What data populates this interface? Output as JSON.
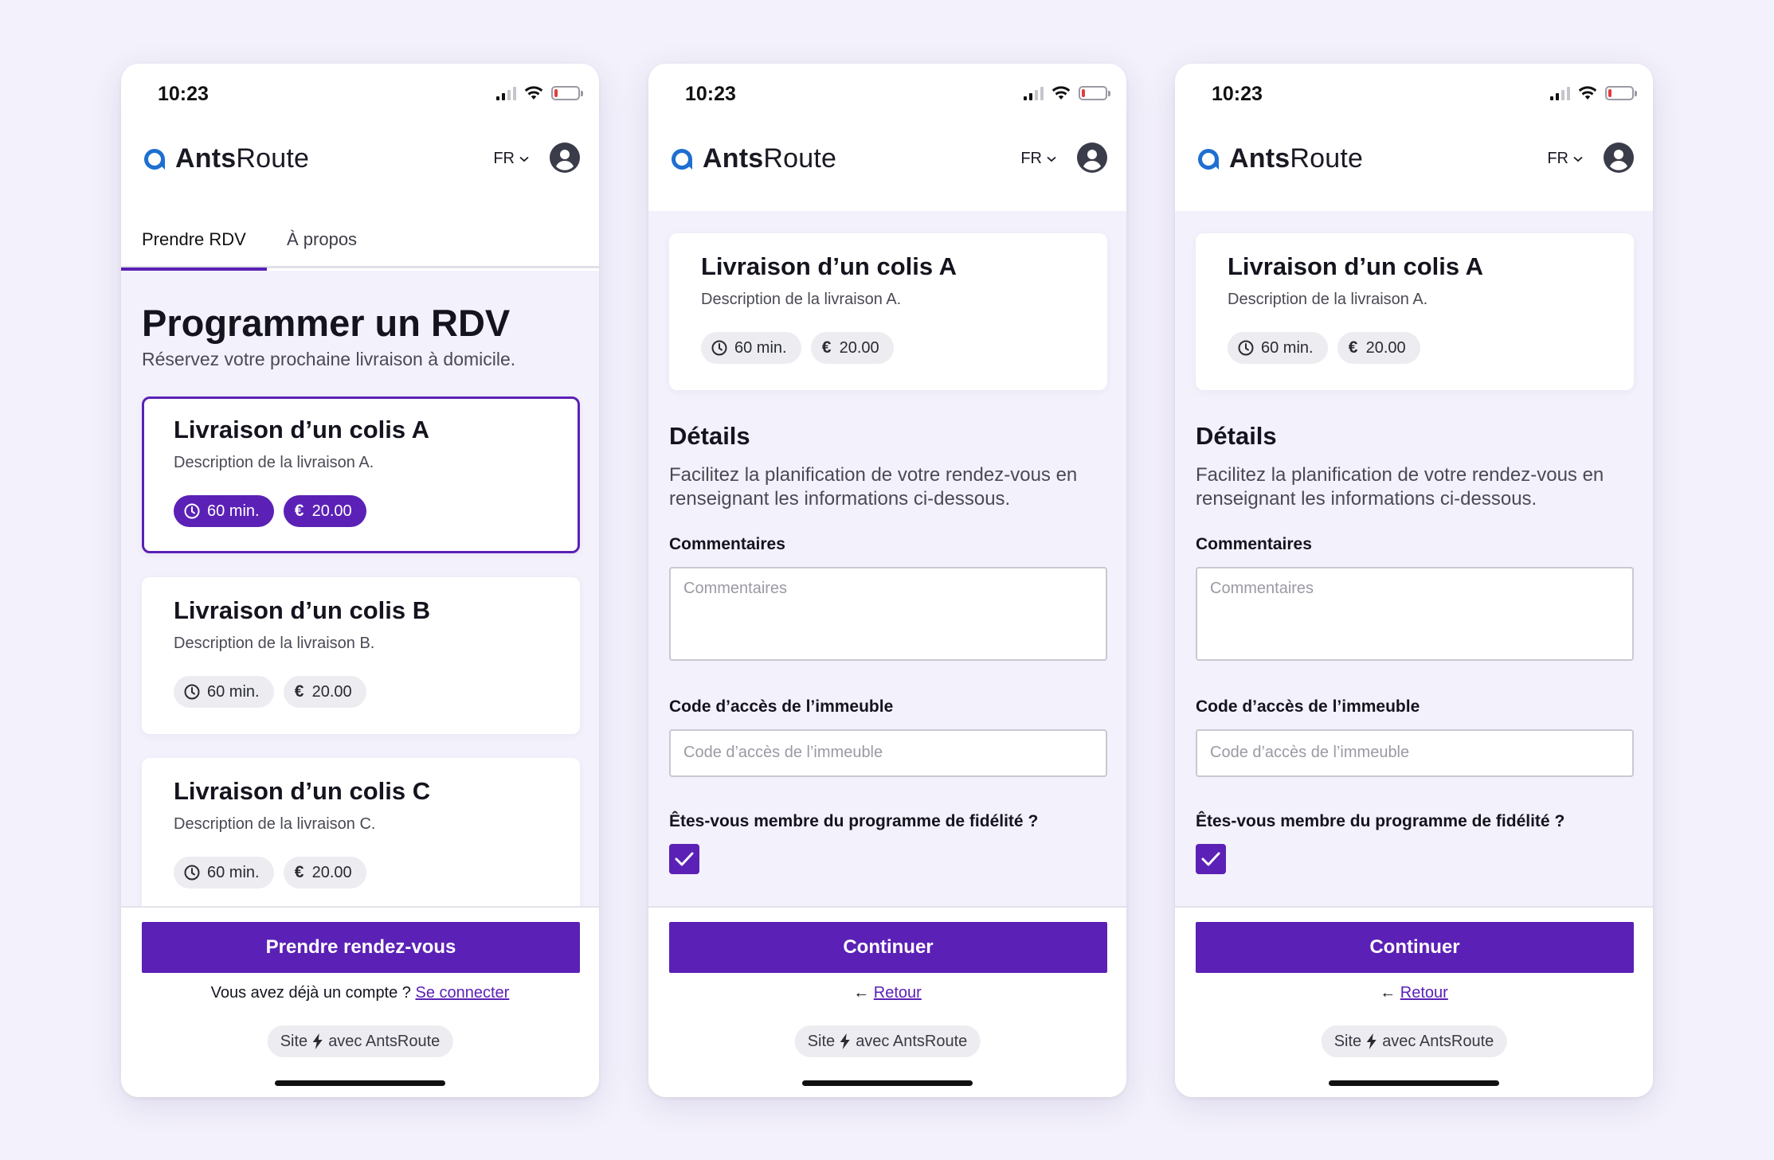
{
  "colors": {
    "accent": "#5b21b6",
    "background": "#f3f1fb",
    "chip": "#ececf1"
  },
  "status": {
    "time": "10:23"
  },
  "brand": {
    "bold": "Ants",
    "regular": "Route"
  },
  "lang": "FR",
  "icons": {
    "logo": "logo-mark-icon",
    "avatar": "user-avatar-icon",
    "clock": "clock-icon",
    "bolt": "lightning-icon",
    "check": "check-icon",
    "chevron": "chevron-down-icon"
  },
  "screen1": {
    "tabs": [
      {
        "label": "Prendre RDV",
        "active": true
      },
      {
        "label": "À propos",
        "active": false
      }
    ],
    "title": "Programmer un RDV",
    "subtitle": "Réservez votre prochaine livraison à domicile.",
    "services": [
      {
        "title": "Livraison d’un colis A",
        "desc": "Description de la livraison A.",
        "duration": "60 min.",
        "price": "20.00",
        "selected": true
      },
      {
        "title": "Livraison d’un colis B",
        "desc": "Description de la livraison B.",
        "duration": "60 min.",
        "price": "20.00",
        "selected": false
      },
      {
        "title": "Livraison d’un colis C",
        "desc": "Description de la livraison C.",
        "duration": "60 min.",
        "price": "20.00",
        "selected": false
      }
    ],
    "cta": "Prendre rendez-vous",
    "account_prompt": "Vous avez déjà un compte ?",
    "login_link": "Se connecter"
  },
  "details": {
    "service": {
      "title": "Livraison d’un colis A",
      "desc": "Description de la livraison A.",
      "duration": "60 min.",
      "price": "20.00"
    },
    "title": "Détails",
    "subtitle": "Facilitez la planification de votre rendez-vous en renseignant les informations ci-dessous.",
    "comments_label": "Commentaires",
    "comments_placeholder": "Commentaires",
    "code_label": "Code d’accès de l’immeuble",
    "code_placeholder": "Code d’accès de l’immeuble",
    "loyalty_label": "Êtes-vous membre du programme de fidélité ?",
    "loyalty_checked": true,
    "cta": "Continuer",
    "back": "Retour"
  },
  "powered": {
    "prefix": "Site",
    "suffix": "avec AntsRoute"
  }
}
